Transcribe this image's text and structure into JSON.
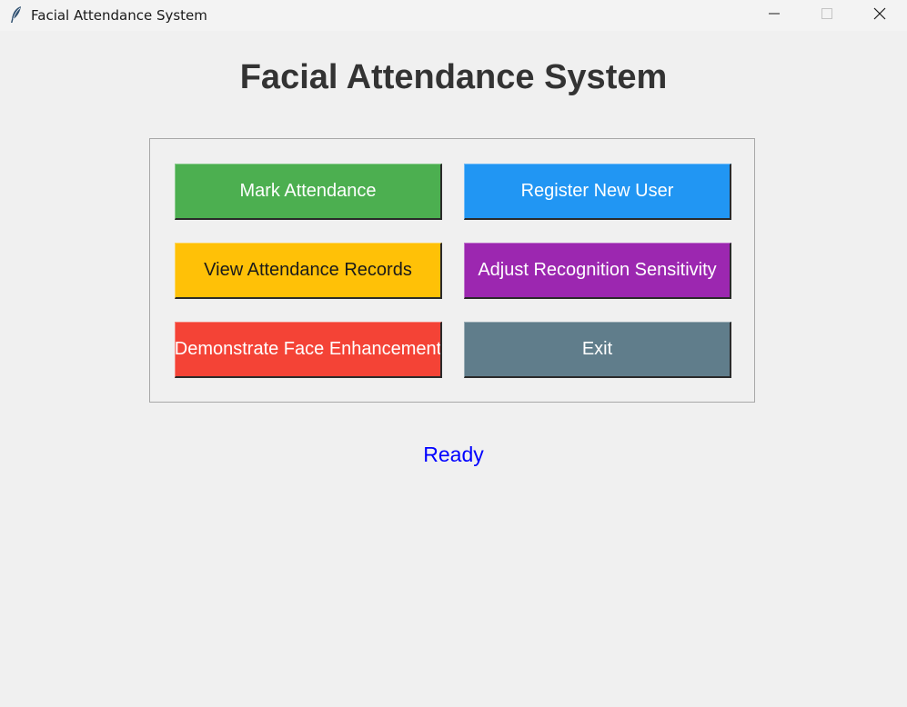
{
  "window": {
    "title": "Facial Attendance System",
    "app_icon": "feather-icon",
    "controls": {
      "minimize_icon": "minimize-icon",
      "maximize_icon": "maximize-icon",
      "close_icon": "close-icon"
    }
  },
  "main": {
    "heading": "Facial Attendance System",
    "buttons": [
      {
        "label": "Mark Attendance",
        "bg": "#4caf50",
        "fg": "#ffffff"
      },
      {
        "label": "Register New User",
        "bg": "#2196f3",
        "fg": "#ffffff"
      },
      {
        "label": "View Attendance Records",
        "bg": "#ffc107",
        "fg": "#1a1a1a"
      },
      {
        "label": "Adjust Recognition Sensitivity",
        "bg": "#9c27b0",
        "fg": "#ffffff"
      },
      {
        "label": "Demonstrate Face Enhancement",
        "bg": "#f44336",
        "fg": "#ffffff"
      },
      {
        "label": "Exit",
        "bg": "#607d8b",
        "fg": "#ffffff"
      }
    ],
    "status": {
      "text": "Ready",
      "color": "#0000ff"
    }
  },
  "colors": {
    "background": "#f0f0f0",
    "heading": "#333333",
    "panel_border": "#a8a8a8"
  }
}
